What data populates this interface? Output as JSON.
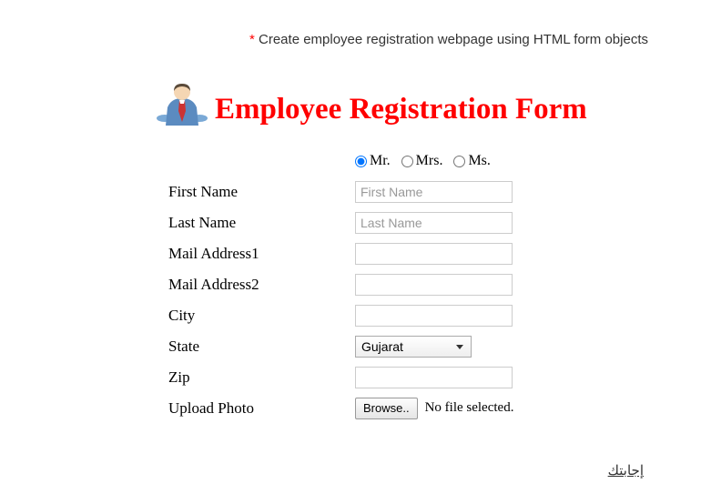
{
  "instruction": {
    "asterisk": "*",
    "text": " Create employee registration webpage using HTML form objects"
  },
  "header": {
    "title": "Employee Registration Form"
  },
  "salutations": {
    "opt1": "Mr.",
    "opt2": "Mrs.",
    "opt3": "Ms.",
    "selected": "Mr."
  },
  "fields": {
    "first_name": {
      "label": "First Name",
      "placeholder": "First Name",
      "value": ""
    },
    "last_name": {
      "label": "Last Name",
      "placeholder": "Last Name",
      "value": ""
    },
    "mail1": {
      "label": "Mail Address1",
      "value": ""
    },
    "mail2": {
      "label": "Mail Address2",
      "value": ""
    },
    "city": {
      "label": "City",
      "value": ""
    },
    "state": {
      "label": "State",
      "value": "Gujarat"
    },
    "zip": {
      "label": "Zip",
      "value": ""
    },
    "photo": {
      "label": "Upload Photo",
      "button": "Browse..",
      "status": "No file selected."
    }
  },
  "footer": {
    "link": "إجابتك"
  }
}
